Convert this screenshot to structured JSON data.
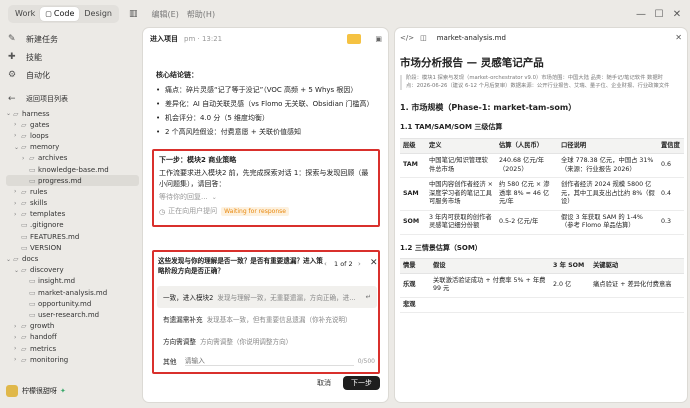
{
  "topbar": {
    "tabs": [
      "Work",
      "Code",
      "Design"
    ],
    "active_tab": "Code",
    "menu": [
      "编辑(E)",
      "帮助(H)"
    ],
    "window_controls": [
      "—",
      "☐",
      "✕"
    ]
  },
  "sidebar": {
    "nav": [
      {
        "icon": "✎",
        "label": "新建任务"
      },
      {
        "icon": "✚",
        "label": "技能"
      },
      {
        "icon": "⚙",
        "label": "自动化"
      }
    ],
    "back_label": "返回项目列表",
    "tree": [
      {
        "label": "harness",
        "depth": 0,
        "type": "folder-open"
      },
      {
        "label": "gates",
        "depth": 1,
        "type": "folder"
      },
      {
        "label": "loops",
        "depth": 1,
        "type": "folder"
      },
      {
        "label": "memory",
        "depth": 1,
        "type": "folder-open"
      },
      {
        "label": "archives",
        "depth": 2,
        "type": "folder"
      },
      {
        "label": "knowledge-base.md",
        "depth": 2,
        "type": "file"
      },
      {
        "label": "progress.md",
        "depth": 2,
        "type": "file",
        "selected": true
      },
      {
        "label": "rules",
        "depth": 1,
        "type": "folder"
      },
      {
        "label": "skills",
        "depth": 1,
        "type": "folder"
      },
      {
        "label": "templates",
        "depth": 1,
        "type": "folder"
      },
      {
        "label": ".gitignore",
        "depth": 1,
        "type": "file"
      },
      {
        "label": "FEATURES.md",
        "depth": 1,
        "type": "file"
      },
      {
        "label": "VERSION",
        "depth": 1,
        "type": "file"
      },
      {
        "label": "docs",
        "depth": 0,
        "type": "folder-open"
      },
      {
        "label": "discovery",
        "depth": 1,
        "type": "folder-open"
      },
      {
        "label": "insight.md",
        "depth": 2,
        "type": "file"
      },
      {
        "label": "market-analysis.md",
        "depth": 2,
        "type": "file"
      },
      {
        "label": "opportunity.md",
        "depth": 2,
        "type": "file"
      },
      {
        "label": "user-research.md",
        "depth": 2,
        "type": "file"
      },
      {
        "label": "growth",
        "depth": 1,
        "type": "folder"
      },
      {
        "label": "handoff",
        "depth": 1,
        "type": "folder"
      },
      {
        "label": "metrics",
        "depth": 1,
        "type": "folder"
      },
      {
        "label": "monitoring",
        "depth": 1,
        "type": "folder"
      }
    ],
    "user": {
      "name": "柠檬很甜呀",
      "badge": "✦"
    }
  },
  "mid": {
    "header": {
      "title": "进入项目",
      "meta": "pm · 13:21"
    },
    "summary_title": "核心结论链：",
    "bullets": [
      "痛点：碎片灵感“记了等于没记”（VOC 高频 + 5 Whys 根因）",
      "差异化：AI 自动关联灵感（vs Flomo 无关联、Obsidian 门槛高）",
      "机会评分：4.0 分（5 维度均衡）",
      "2 个高风险假设：付费意愿 + 关联价值感知"
    ],
    "next": {
      "title": "下一步：模块2 商业策略",
      "body": "工作流要求进入模块2 前，先完成探索对话 1：探索与发现回顾（最小问题集），请回答：",
      "waiting": "等待你的回复...",
      "status": "正在向用户提问",
      "badge": "Waiting for response"
    },
    "question": {
      "title": "这些发现与你的理解是否一致？是否有重要遗漏？进入策略阶段方向是否正确？",
      "pager": "1 of 2",
      "options": [
        {
          "label": "一致，进入模块2",
          "desc": "发现与理解一致，无重要遗漏，方向正确，进..."
        },
        {
          "label": "有遗漏需补充",
          "desc": "发现基本一致，但有重要信息遗漏（你补充说明）"
        },
        {
          "label": "方向需调整",
          "desc": "方向需调整（你说明调整方向）"
        }
      ],
      "other_label": "其他",
      "other_placeholder": "请输入",
      "counter": "0/500"
    },
    "cancel": "取消",
    "next_btn": "下一步"
  },
  "right": {
    "filename": "market-analysis.md",
    "h1": "市场分析报告 — 灵感笔记产品",
    "meta": "阶段：模块1 探索与发现（market-orchestrator v9.0）市场范围：中国大陆 品类：随手记/笔记软件 数据时点：2026-06-26（建议 6-12 个月后复审）数据来源：公开行业报告、艾瑞、量子位、企业财报、行业政策文件",
    "h2": "1. 市场规模（Phase-1: market-tam-som）",
    "h3a": "1.1 TAM/SAM/SOM 三级估算",
    "table1": {
      "headers": [
        "层级",
        "定义",
        "估算（人民币）",
        "口径说明",
        "置信度"
      ],
      "rows": [
        [
          "TAM",
          "中国笔记/知识管理软件总市场",
          "240.68 亿元/年（2025）",
          "全球 778.38 亿元，中国占 31%（来源：行业报告 2026）",
          "0.6"
        ],
        [
          "SAM",
          "中国内容创作者经济 × 深度学习者的笔记工具可服务市场",
          "约 580 亿元 × 渗透率 8% ≈ 46 亿元/年",
          "创作者经济 2024 规模 5800 亿元，其中工具支出占比约 8%（假设）",
          "0.4"
        ],
        [
          "SOM",
          "3 年内可获取的创作者灵感笔记细分份额",
          "0.5-2 亿元/年",
          "假设 3 年获取 SAM 的 1-4%（参考 Flomo 单品估算）",
          "0.3"
        ]
      ]
    },
    "h3b": "1.2 三情景估算（SOM）",
    "table2": {
      "headers": [
        "情景",
        "假设",
        "3 年 SOM",
        "关键驱动"
      ],
      "rows": [
        [
          "乐观",
          "关联激活验证成功 + 付费率 5% + 年费 99 元",
          "2.0 亿",
          "痛点验证 + 差异化付费意高"
        ],
        [
          "悲观",
          "",
          "",
          ""
        ]
      ]
    }
  }
}
